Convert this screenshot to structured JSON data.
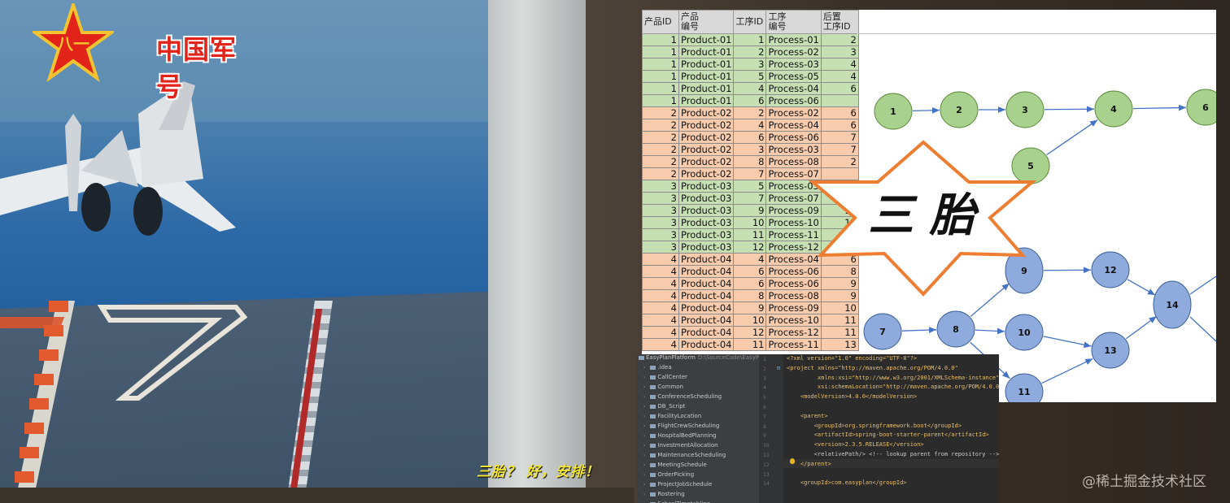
{
  "logo": {
    "text": "中国军号",
    "emblem_char": "八一",
    "icon": "red-star-emblem-icon"
  },
  "subtitle": "三胎？ 好，安排！",
  "banner": "三 胎",
  "watermark": "@稀土掘金技术社区",
  "colors": {
    "green_row": "#c6e0b4",
    "orange_row": "#f8cbad",
    "green_node": "#a9d18e",
    "blue_node": "#8faadc",
    "banner_outline": "#ed7d31"
  },
  "sheet": {
    "headers": [
      "产品ID",
      "产品\n编号",
      "工序ID",
      "工序\n编号",
      "后置\n工序ID"
    ],
    "rows": [
      {
        "c": "g",
        "pid": "1",
        "pno": "Product-01",
        "sid": "1",
        "sno": "Process-01",
        "next": "2"
      },
      {
        "c": "g",
        "pid": "1",
        "pno": "Product-01",
        "sid": "2",
        "sno": "Process-02",
        "next": "3"
      },
      {
        "c": "g",
        "pid": "1",
        "pno": "Product-01",
        "sid": "3",
        "sno": "Process-03",
        "next": "4"
      },
      {
        "c": "g",
        "pid": "1",
        "pno": "Product-01",
        "sid": "5",
        "sno": "Process-05",
        "next": "4"
      },
      {
        "c": "g",
        "pid": "1",
        "pno": "Product-01",
        "sid": "4",
        "sno": "Process-04",
        "next": "6"
      },
      {
        "c": "g",
        "pid": "1",
        "pno": "Product-01",
        "sid": "6",
        "sno": "Process-06",
        "next": ""
      },
      {
        "c": "o",
        "pid": "2",
        "pno": "Product-02",
        "sid": "2",
        "sno": "Process-02",
        "next": "6"
      },
      {
        "c": "o",
        "pid": "2",
        "pno": "Product-02",
        "sid": "4",
        "sno": "Process-04",
        "next": "6"
      },
      {
        "c": "o",
        "pid": "2",
        "pno": "Product-02",
        "sid": "6",
        "sno": "Process-06",
        "next": "7"
      },
      {
        "c": "o",
        "pid": "2",
        "pno": "Product-02",
        "sid": "3",
        "sno": "Process-03",
        "next": "7"
      },
      {
        "c": "o",
        "pid": "2",
        "pno": "Product-02",
        "sid": "8",
        "sno": "Process-08",
        "next": "2"
      },
      {
        "c": "o",
        "pid": "2",
        "pno": "Product-02",
        "sid": "7",
        "sno": "Process-07",
        "next": ""
      },
      {
        "c": "g",
        "pid": "3",
        "pno": "Product-03",
        "sid": "5",
        "sno": "Process-05",
        "next": "7"
      },
      {
        "c": "g",
        "pid": "3",
        "pno": "Product-03",
        "sid": "7",
        "sno": "Process-07",
        "next": "9"
      },
      {
        "c": "g",
        "pid": "3",
        "pno": "Product-03",
        "sid": "9",
        "sno": "Process-09",
        "next": "11"
      },
      {
        "c": "g",
        "pid": "3",
        "pno": "Product-03",
        "sid": "10",
        "sno": "Process-10",
        "next": "11"
      },
      {
        "c": "g",
        "pid": "3",
        "pno": "Product-03",
        "sid": "11",
        "sno": "Process-11",
        "next": "12"
      },
      {
        "c": "g",
        "pid": "3",
        "pno": "Product-03",
        "sid": "12",
        "sno": "Process-12",
        "next": ""
      },
      {
        "c": "o",
        "pid": "4",
        "pno": "Product-04",
        "sid": "4",
        "sno": "Process-04",
        "next": "6"
      },
      {
        "c": "o",
        "pid": "4",
        "pno": "Product-04",
        "sid": "6",
        "sno": "Process-06",
        "next": "8"
      },
      {
        "c": "o",
        "pid": "4",
        "pno": "Product-04",
        "sid": "6",
        "sno": "Process-06",
        "next": "9"
      },
      {
        "c": "o",
        "pid": "4",
        "pno": "Product-04",
        "sid": "8",
        "sno": "Process-08",
        "next": "9"
      },
      {
        "c": "o",
        "pid": "4",
        "pno": "Product-04",
        "sid": "9",
        "sno": "Process-09",
        "next": "10"
      },
      {
        "c": "o",
        "pid": "4",
        "pno": "Product-04",
        "sid": "10",
        "sno": "Process-10",
        "next": "11"
      },
      {
        "c": "o",
        "pid": "4",
        "pno": "Product-04",
        "sid": "12",
        "sno": "Process-12",
        "next": "11"
      },
      {
        "c": "o",
        "pid": "4",
        "pno": "Product-04",
        "sid": "11",
        "sno": "Process-11",
        "next": "13"
      }
    ]
  },
  "graph": {
    "nodes": [
      "1",
      "2",
      "3",
      "4",
      "5",
      "6",
      "7",
      "8",
      "9",
      "10",
      "11",
      "12",
      "13",
      "14"
    ]
  },
  "ide": {
    "project": "EasyPlanPlatform",
    "project_path": "D:\\SourceCode\\EasyP",
    "tree": [
      ".idea",
      "CallCenter",
      "Common",
      "ConferenceScheduling",
      "DB_Script",
      "FacilityLocation",
      "FlightCrewScheduling",
      "HospitalBedPlanning",
      "InvestmentAllocation",
      "MaintenanceScheduling",
      "MeetingSchedule",
      "OrderPicking",
      "ProjectJobSchedule",
      "Rostering",
      "SchoolTimetabling"
    ],
    "line_numbers": [
      "1",
      "2",
      "3",
      "4",
      "5",
      "6",
      "7",
      "8",
      "9",
      "10",
      "11",
      "12",
      "13",
      "14"
    ],
    "code": [
      "<?xml version=\"1.0\" encoding=\"UTF-8\"?>",
      "<project xmlns=\"http://maven.apache.org/POM/4.0.0\"",
      "         xmlns:xsi=\"http://www.w3.org/2001/XMLSchema-instance\"",
      "         xsi:schemaLocation=\"http://maven.apache.org/POM/4.0.0",
      "    <modelVersion>4.0.0</modelVersion>",
      "",
      "    <parent>",
      "        <groupId>org.springframework.boot</groupId>",
      "        <artifactId>spring-boot-starter-parent</artifactId>",
      "        <version>2.3.5.RELEASE</version>",
      "        <relativePath/> <!-- lookup parent from repository -->",
      "    </parent>",
      "",
      "    <groupId>com.easyplan</groupId>"
    ]
  }
}
